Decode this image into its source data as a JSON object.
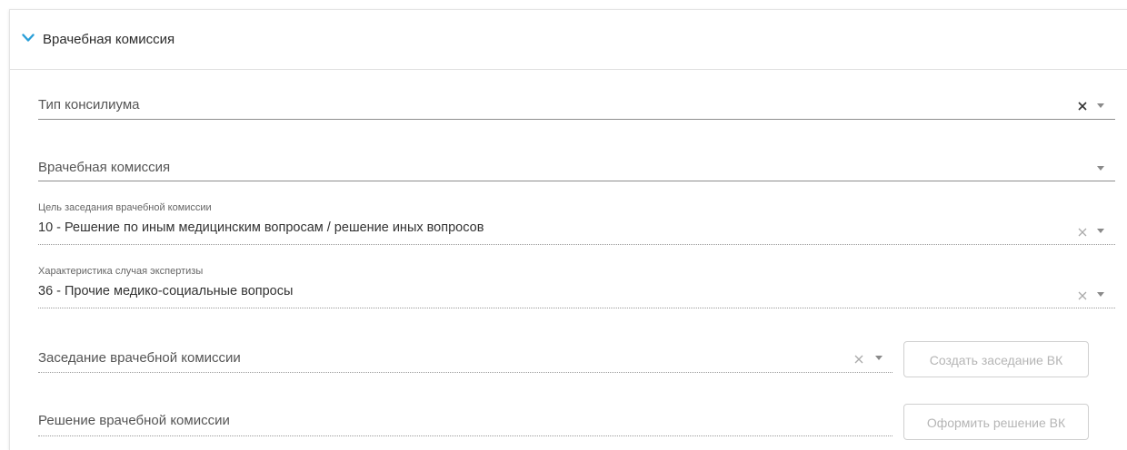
{
  "section": {
    "title": "Врачебная комиссия",
    "expanded": true
  },
  "fields": {
    "consilium_type": {
      "placeholder": "Тип консилиума"
    },
    "medical_commission": {
      "placeholder": "Врачебная комиссия"
    },
    "session_goal": {
      "label": "Цель заседания врачебной комиссии",
      "value": "10 - Решение по иным медицинским вопросам / решение иных вопросов"
    },
    "case_characteristic": {
      "label": "Характеристика случая экспертизы",
      "value": "36 - Прочие медико-социальные вопросы"
    },
    "commission_session": {
      "placeholder": "Заседание врачебной комиссии"
    },
    "commission_decision": {
      "placeholder": "Решение врачебной комиссии"
    }
  },
  "buttons": {
    "create_session": "Создать заседание ВК",
    "make_decision": "Оформить решение ВК"
  },
  "colors": {
    "accent": "#2a9fd8"
  }
}
